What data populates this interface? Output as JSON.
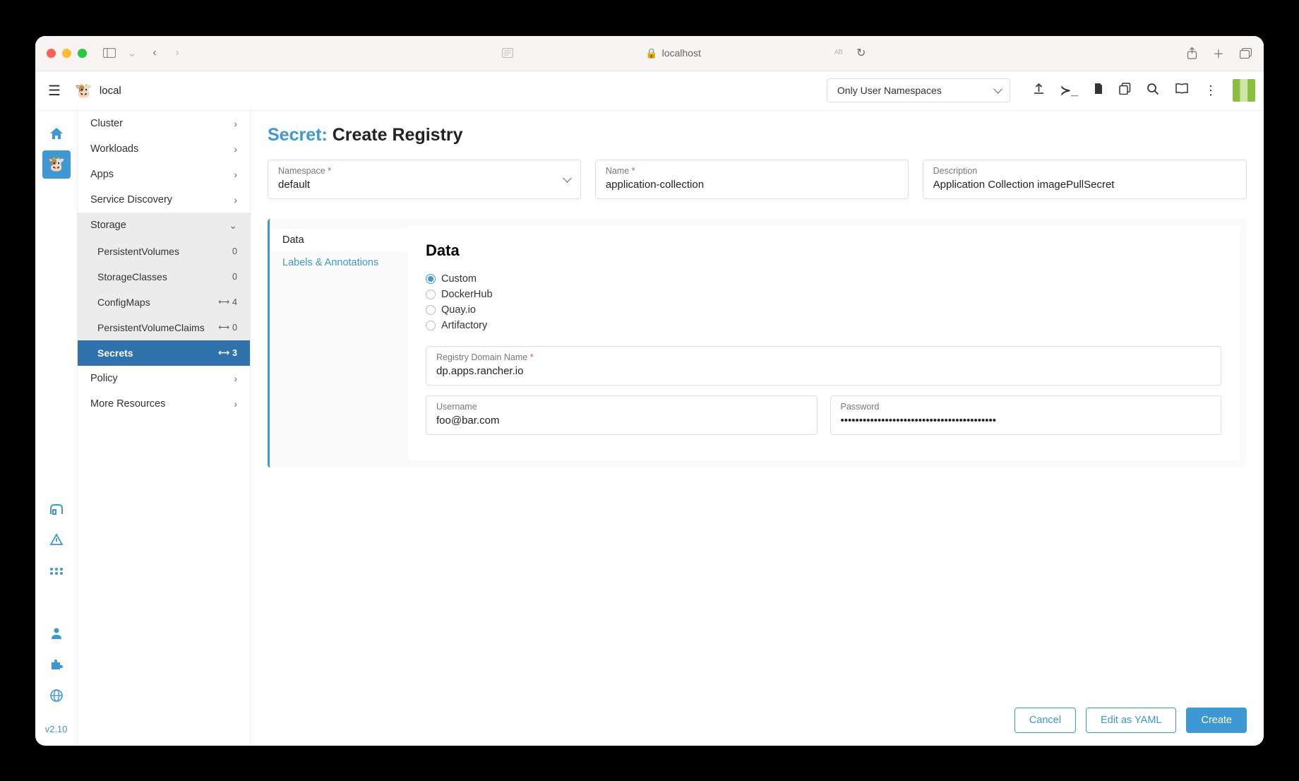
{
  "browser": {
    "address": "localhost"
  },
  "appbar": {
    "cluster": "local",
    "namespace_filter": "Only User Namespaces"
  },
  "rail": {
    "version": "v2.10"
  },
  "sidenav": {
    "cluster": "Cluster",
    "workloads": "Workloads",
    "apps": "Apps",
    "service_discovery": "Service Discovery",
    "storage": {
      "label": "Storage",
      "pv": {
        "label": "PersistentVolumes",
        "count": "0"
      },
      "sc": {
        "label": "StorageClasses",
        "count": "0"
      },
      "cm": {
        "label": "ConfigMaps",
        "count": "4"
      },
      "pvc": {
        "label": "PersistentVolumeClaims",
        "count": "0"
      },
      "secrets": {
        "label": "Secrets",
        "count": "3"
      }
    },
    "policy": "Policy",
    "more": "More Resources"
  },
  "page": {
    "title_prefix": "Secret:",
    "title_main": "Create Registry"
  },
  "form": {
    "namespace": {
      "label": "Namespace",
      "value": "default"
    },
    "name": {
      "label": "Name",
      "value": "application-collection"
    },
    "description": {
      "label": "Description",
      "value": "Application Collection imagePullSecret"
    }
  },
  "tabs": {
    "data": "Data",
    "labels": "Labels & Annotations"
  },
  "data": {
    "heading": "Data",
    "radios": {
      "custom": "Custom",
      "dockerhub": "DockerHub",
      "quay": "Quay.io",
      "artifactory": "Artifactory"
    },
    "registry": {
      "label": "Registry Domain Name",
      "value": "dp.apps.rancher.io"
    },
    "username": {
      "label": "Username",
      "value": "foo@bar.com"
    },
    "password": {
      "label": "Password",
      "value": "••••••••••••••••••••••••••••••••••••••••••"
    }
  },
  "footer": {
    "cancel": "Cancel",
    "yaml": "Edit as YAML",
    "create": "Create"
  }
}
